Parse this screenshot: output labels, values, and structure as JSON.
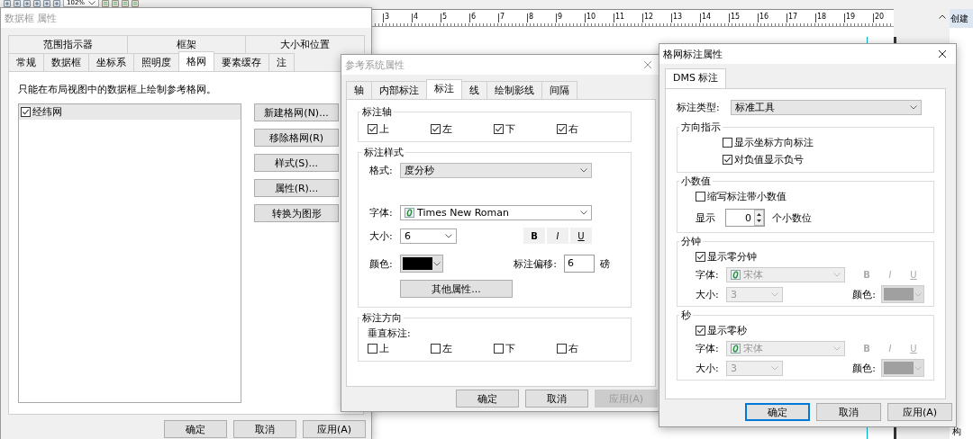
{
  "toolbar": {
    "zoom": "102%"
  },
  "ruler": {
    "labels": [
      "3",
      "4",
      "5",
      "6",
      "7",
      "8",
      "9",
      "10",
      "11",
      "12",
      "13",
      "14",
      "15",
      "16",
      "17",
      "18",
      "19",
      "20"
    ]
  },
  "side_panel": {
    "title": "创建",
    "footer": "构"
  },
  "data_frame_dialog": {
    "title": "数据框 属性",
    "active": false,
    "tab_rows": [
      [
        {
          "label": "范围指示器",
          "selected": false
        },
        {
          "label": "框架",
          "selected": false
        },
        {
          "label": "大小和位置",
          "selected": false
        }
      ],
      [
        {
          "label": "常规",
          "selected": false
        },
        {
          "label": "数据框",
          "selected": false
        },
        {
          "label": "坐标系",
          "selected": false
        },
        {
          "label": "照明度",
          "selected": false
        },
        {
          "label": "格网",
          "selected": true
        },
        {
          "label": "要素缓存",
          "selected": false
        },
        {
          "label": "注",
          "selected": false
        }
      ]
    ],
    "note": "只能在布局视图中的数据框上绘制参考格网。",
    "grids": [
      {
        "label": "经纬网",
        "checked": true,
        "selected": true
      }
    ],
    "side_buttons": [
      "新建格网(N)...",
      "移除格网(R)",
      "样式(S)...",
      "属性(R)...",
      "转换为图形"
    ],
    "buttons": [
      {
        "label": "确定",
        "disabled": false
      },
      {
        "label": "取消",
        "disabled": false
      },
      {
        "label": "应用(A)",
        "disabled": false
      }
    ]
  },
  "reference_system_dialog": {
    "title": "参考系统属性",
    "active": false,
    "tabs": [
      {
        "label": "轴",
        "selected": false
      },
      {
        "label": "内部标注",
        "selected": false
      },
      {
        "label": "标注",
        "selected": true
      },
      {
        "label": "线",
        "selected": false
      },
      {
        "label": "绘制影线",
        "selected": false
      },
      {
        "label": "间隔",
        "selected": false
      }
    ],
    "label_axes": {
      "title": "标注轴",
      "options": [
        {
          "label": "上",
          "checked": true
        },
        {
          "label": "左",
          "checked": true
        },
        {
          "label": "下",
          "checked": true
        },
        {
          "label": "右",
          "checked": true
        }
      ]
    },
    "label_style": {
      "title": "标注样式",
      "format": {
        "label": "格式:",
        "value": "度分秒",
        "kind": "list"
      },
      "font": {
        "label": "字体:",
        "value": "Times New Roman",
        "kind": "combo"
      },
      "size": {
        "label": "大小:",
        "value": "6",
        "kind": "combo"
      },
      "style_buttons": [
        {
          "label": "B",
          "kind": "bold"
        },
        {
          "label": "I",
          "kind": "italic"
        },
        {
          "label": "U",
          "kind": "underline"
        }
      ],
      "color": {
        "label": "颜色:",
        "color": "#000000"
      },
      "offset": {
        "label": "标注偏移:",
        "value": "6",
        "unit": "磅"
      },
      "more_button": "其他属性..."
    },
    "label_orientation": {
      "title": "标注方向",
      "subtitle": "垂直标注:",
      "options": [
        {
          "label": "上",
          "checked": false
        },
        {
          "label": "左",
          "checked": false
        },
        {
          "label": "下",
          "checked": false
        },
        {
          "label": "右",
          "checked": false
        }
      ]
    },
    "buttons": [
      {
        "label": "确定",
        "disabled": false
      },
      {
        "label": "取消",
        "disabled": false
      },
      {
        "label": "应用(A)",
        "disabled": true
      }
    ]
  },
  "grid_label_dialog": {
    "title": "格网标注属性",
    "active": true,
    "tab": {
      "label": "DMS 标注",
      "selected": true
    },
    "label_type": {
      "label": "标注类型:",
      "value": "标准工具",
      "kind": "list"
    },
    "direction": {
      "title": "方向指示",
      "options": [
        {
          "label": "显示坐标方向标注",
          "checked": false
        },
        {
          "label": "对负值显示负号",
          "checked": true
        }
      ]
    },
    "decimal": {
      "title": "小数值",
      "option": {
        "label": "缩写标注带小数值",
        "checked": false
      },
      "show_label": "显示",
      "places": "0",
      "places_suffix": "个小数位"
    },
    "parts": [
      {
        "title": "分钟",
        "option": {
          "label": "显示零分钟",
          "checked": true
        },
        "font": {
          "label": "字体:",
          "value": "宋体",
          "disabled": true
        },
        "style_buttons": [
          {
            "label": "B",
            "kind": "bold"
          },
          {
            "label": "I",
            "kind": "italic"
          },
          {
            "label": "U",
            "kind": "underline"
          }
        ],
        "size": {
          "label": "大小:",
          "value": "3",
          "disabled": true
        },
        "color": {
          "label": "颜色:",
          "color": "#a0a0a0"
        }
      },
      {
        "title": "秒",
        "option": {
          "label": "显示零秒",
          "checked": true
        },
        "font": {
          "label": "字体:",
          "value": "宋体",
          "disabled": true
        },
        "style_buttons": [
          {
            "label": "B",
            "kind": "bold"
          },
          {
            "label": "I",
            "kind": "italic"
          },
          {
            "label": "U",
            "kind": "underline"
          }
        ],
        "size": {
          "label": "大小:",
          "value": "3",
          "disabled": true
        },
        "color": {
          "label": "颜色:",
          "color": "#a0a0a0"
        }
      }
    ],
    "buttons": [
      {
        "label": "确定",
        "focused": true
      },
      {
        "label": "取消",
        "focused": false
      },
      {
        "label": "应用(A)",
        "focused": false
      }
    ]
  }
}
